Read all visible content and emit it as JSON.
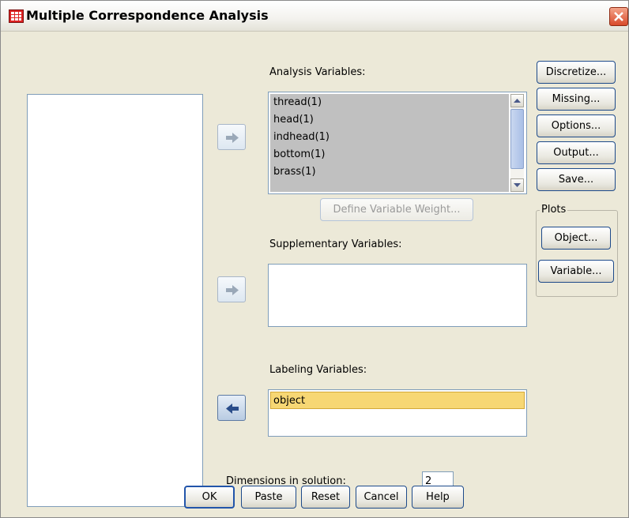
{
  "window": {
    "title": "Multiple Correspondence Analysis"
  },
  "analysis": {
    "label": "Analysis Variables:",
    "items": [
      "thread(1)",
      "head(1)",
      "indhead(1)",
      "bottom(1)",
      "brass(1)"
    ],
    "define_weight": "Define Variable Weight..."
  },
  "supplementary": {
    "label": "Supplementary Variables:"
  },
  "labeling": {
    "label": "Labeling Variables:",
    "items": [
      "object"
    ]
  },
  "dimensions": {
    "label": "Dimensions in solution:",
    "value": "2"
  },
  "side_buttons": {
    "discretize": "Discretize...",
    "missing": "Missing...",
    "options": "Options...",
    "output": "Output...",
    "save": "Save..."
  },
  "plots": {
    "legend": "Plots",
    "object": "Object...",
    "variable": "Variable..."
  },
  "footer": {
    "ok": "OK",
    "paste": "Paste",
    "reset": "Reset",
    "cancel": "Cancel",
    "help": "Help"
  }
}
